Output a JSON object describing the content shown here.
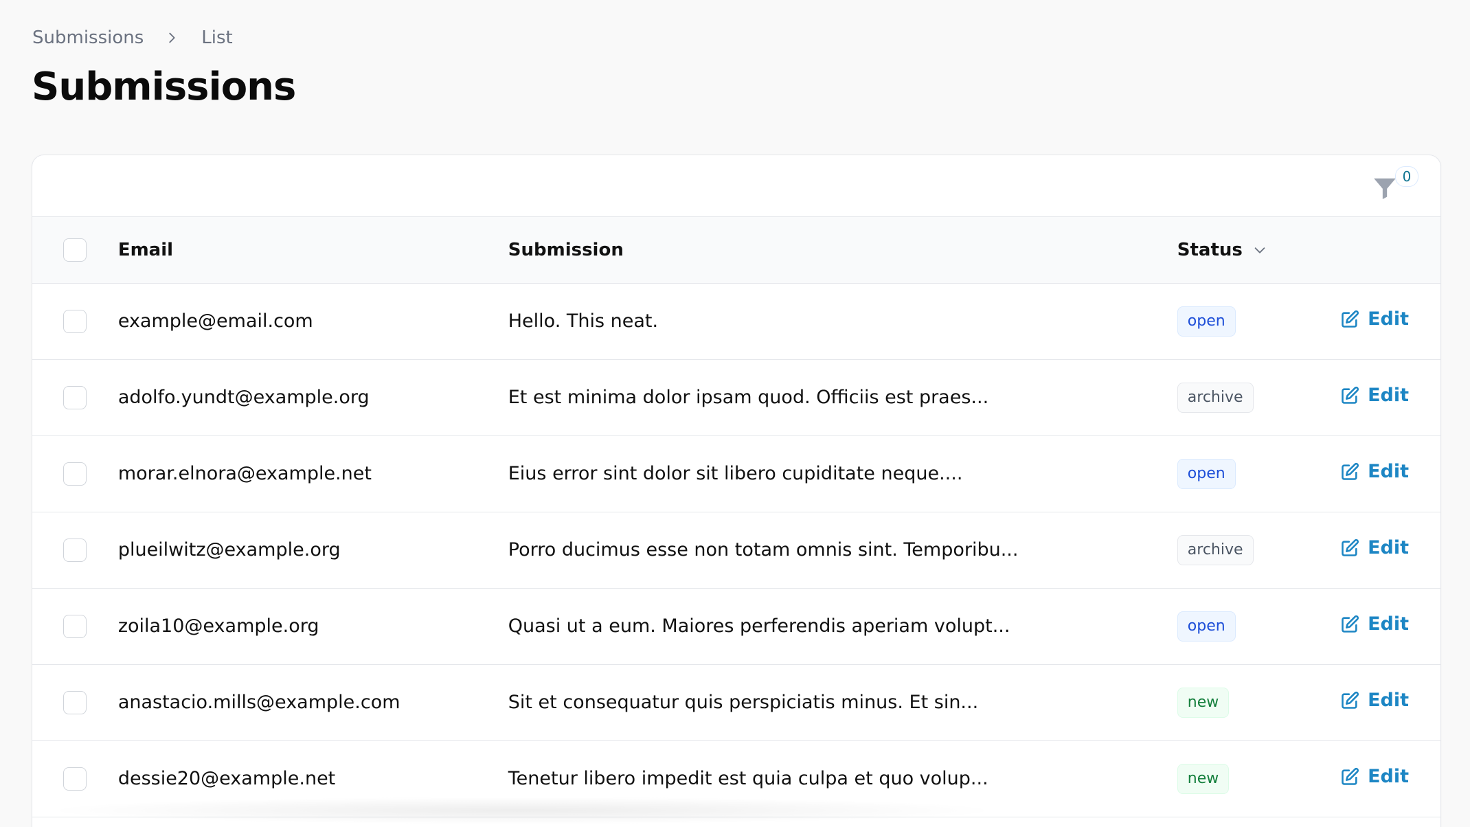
{
  "breadcrumb": {
    "items": [
      "Submissions",
      "List"
    ]
  },
  "page": {
    "title": "Submissions"
  },
  "toolbar": {
    "filter_count": "0"
  },
  "table": {
    "headers": {
      "email": "Email",
      "submission": "Submission",
      "status": "Status"
    },
    "action_label": "Edit",
    "rows": [
      {
        "email": "example@email.com",
        "submission": "Hello. This neat.",
        "status": "open"
      },
      {
        "email": "adolfo.yundt@example.org",
        "submission": "Et est minima dolor ipsam quod. Officiis est praes...",
        "status": "archive"
      },
      {
        "email": "morar.elnora@example.net",
        "submission": "Eius error sint dolor sit libero cupiditate neque....",
        "status": "open"
      },
      {
        "email": "plueilwitz@example.org",
        "submission": "Porro ducimus esse non totam omnis sint. Temporibu...",
        "status": "archive"
      },
      {
        "email": "zoila10@example.org",
        "submission": "Quasi ut a eum. Maiores perferendis aperiam volupt...",
        "status": "open"
      },
      {
        "email": "anastacio.mills@example.com",
        "submission": "Sit et consequatur quis perspiciatis minus. Et sin...",
        "status": "new"
      },
      {
        "email": "dessie20@example.net",
        "submission": "Tenetur libero impedit est quia culpa et quo volup...",
        "status": "new"
      }
    ]
  },
  "icons": {
    "breadcrumb_separator": "chevron-right-icon",
    "filter": "funnel-icon",
    "sort": "chevron-down-icon",
    "edit": "pencil-square-icon"
  },
  "colors": {
    "accent": "#1d86c4",
    "open": "#1d4ed8",
    "archive": "#4b5563",
    "new": "#15803d"
  }
}
